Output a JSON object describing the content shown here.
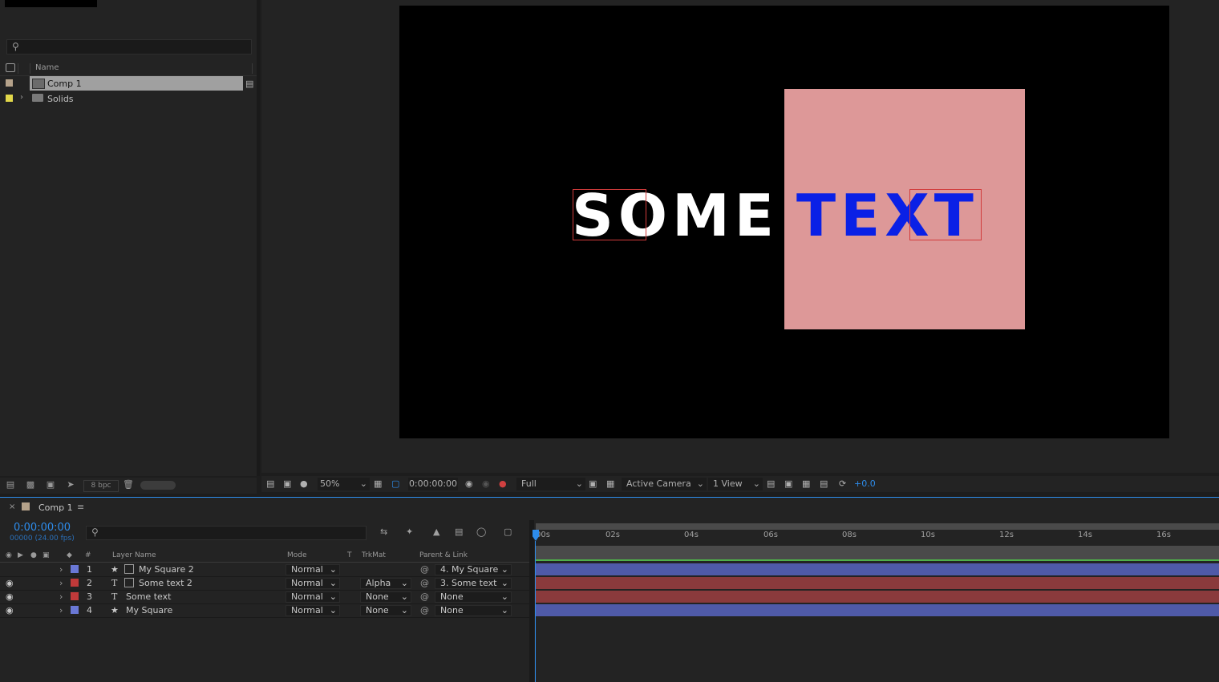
{
  "project": {
    "search_placeholder": "",
    "column_name": "Name",
    "items": [
      {
        "label": "Comp 1",
        "color": "#b5a28a",
        "type": "composition",
        "selected": true
      },
      {
        "label": "Solids",
        "color": "#e2d84a",
        "type": "folder",
        "selected": false
      }
    ],
    "bpc": "8 bpc"
  },
  "viewer": {
    "canvas_text_white": "SOME",
    "canvas_text_blue": "TEXT",
    "square_color": "#dd9898",
    "zoom": "50%",
    "timecode": "0:00:00:00",
    "resolution": "Full",
    "camera": "Active Camera",
    "views": "1 View",
    "exposure": "+0.0"
  },
  "timeline": {
    "tab_label": "Comp 1",
    "timecode": "0:00:00:00",
    "frame_info": "00000 (24.00 fps)",
    "columns": {
      "num": "#",
      "layer_name": "Layer Name",
      "mode": "Mode",
      "t": "T",
      "trkmat": "TrkMat",
      "parent": "Parent & Link"
    },
    "ruler": [
      "00s",
      "02s",
      "04s",
      "06s",
      "08s",
      "10s",
      "12s",
      "14s",
      "16s"
    ],
    "layers": [
      {
        "num": "1",
        "name": "My Square 2",
        "label_color": "#6a78d6",
        "type_icon": "star",
        "mode": "Normal",
        "trkmat": "",
        "parent": "4. My Square",
        "bar_color": "#4f5aa8",
        "visible": false
      },
      {
        "num": "2",
        "name": "Some text 2",
        "label_color": "#c03a3a",
        "type_icon": "T",
        "mode": "Normal",
        "trkmat": "Alpha",
        "parent": "3. Some text",
        "bar_color": "#8a3a3c",
        "visible": true
      },
      {
        "num": "3",
        "name": "Some text",
        "label_color": "#c03a3a",
        "type_icon": "T",
        "mode": "Normal",
        "trkmat": "None",
        "parent": "None",
        "bar_color": "#8a3a3c",
        "visible": true
      },
      {
        "num": "4",
        "name": "My Square",
        "label_color": "#6a78d6",
        "type_icon": "star",
        "mode": "Normal",
        "trkmat": "None",
        "parent": "None",
        "bar_color": "#4f5aa8",
        "visible": true
      }
    ]
  }
}
